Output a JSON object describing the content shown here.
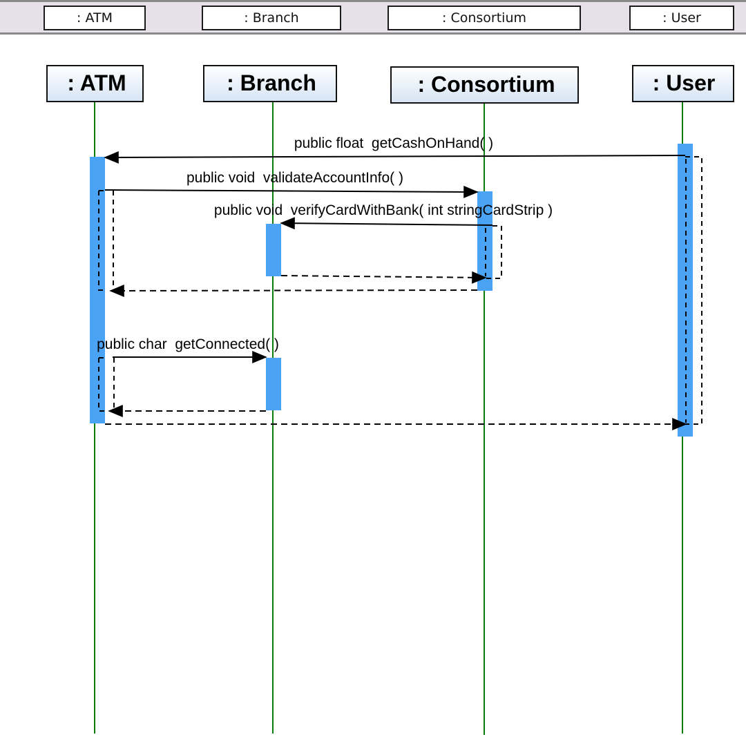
{
  "header": {
    "objects": [
      ": ATM",
      ": Branch",
      ": Consortium",
      ": User"
    ]
  },
  "diagram": {
    "type": "sequence",
    "colors": {
      "lifeline": "#0a7d0a",
      "activation": "#4aa3f5",
      "line": "#000000",
      "header_bg": "#e6e0e8",
      "object_box_top": "#ffffff",
      "object_box_bottom": "#dce8f5"
    },
    "lifelines": [
      {
        "id": "atm",
        "label": ": ATM"
      },
      {
        "id": "branch",
        "label": ": Branch"
      },
      {
        "id": "consortium",
        "label": ": Consortium"
      },
      {
        "id": "user",
        "label": ": User"
      }
    ],
    "messages": [
      {
        "label": "public float  getCashOnHand( )",
        "from": "user",
        "to": "atm",
        "kind": "call"
      },
      {
        "label": "public void  validateAccountInfo( )",
        "from": "atm",
        "to": "consortium",
        "kind": "call"
      },
      {
        "label": "public void  verifyCardWithBank( int stringCardStrip )",
        "from": "consortium",
        "to": "branch",
        "kind": "call"
      },
      {
        "label": "",
        "from": "branch",
        "to": "consortium",
        "kind": "return"
      },
      {
        "label": "",
        "from": "consortium",
        "to": "atm",
        "kind": "return"
      },
      {
        "label": "public char  getConnected( )",
        "from": "atm",
        "to": "branch",
        "kind": "call"
      },
      {
        "label": "",
        "from": "branch",
        "to": "atm",
        "kind": "return"
      },
      {
        "label": "",
        "from": "atm",
        "to": "user",
        "kind": "return"
      }
    ]
  }
}
